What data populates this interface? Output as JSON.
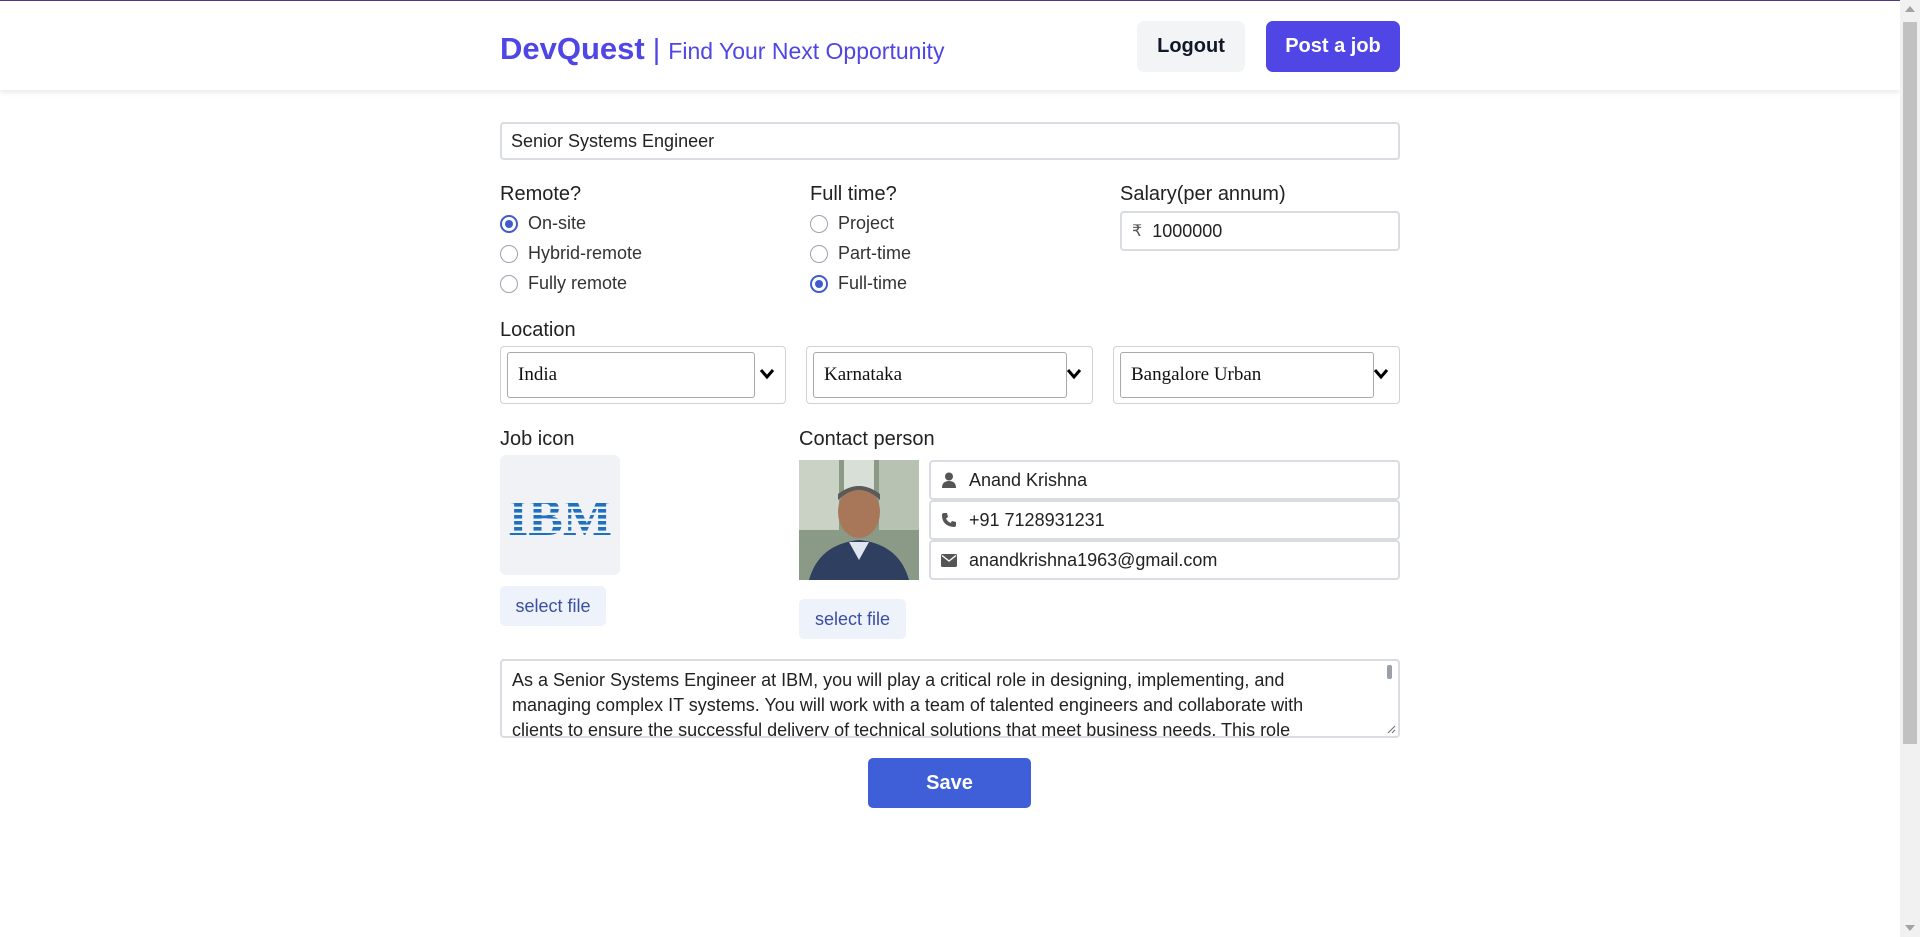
{
  "header": {
    "brand": "DevQuest",
    "separator": "|",
    "tagline": "Find Your Next Opportunity",
    "logout_label": "Logout",
    "post_job_label": "Post a job"
  },
  "form": {
    "job_title": "Senior Systems Engineer",
    "remote": {
      "label": "Remote?",
      "options": [
        "On-site",
        "Hybrid-remote",
        "Fully remote"
      ],
      "selected": "On-site"
    },
    "fulltime": {
      "label": "Full time?",
      "options": [
        "Project",
        "Part-time",
        "Full-time"
      ],
      "selected": "Full-time"
    },
    "salary": {
      "label": "Salary(per annum)",
      "currency": "₹",
      "value": "1000000"
    },
    "location": {
      "label": "Location",
      "country": "India",
      "state": "Karnataka",
      "city": "Bangalore Urban"
    },
    "job_icon": {
      "label": "Job icon",
      "logo_text": "IBM",
      "select_label": "select file"
    },
    "contact": {
      "label": "Contact person",
      "name": "Anand Krishna",
      "phone": "+91 7128931231",
      "email": "anandkrishna1963@gmail.com",
      "select_label": "select file"
    },
    "description": "As a Senior Systems Engineer at IBM, you will play a critical role in designing, implementing, and managing complex IT systems. You will work with a team of talented engineers and collaborate with clients to ensure the successful delivery of technical solutions that meet business needs. This role requires deep technical",
    "save_label": "Save"
  },
  "colors": {
    "brand": "#4f46e5",
    "save": "#3f5fd9",
    "radio_checked": "#3f5ccc"
  }
}
